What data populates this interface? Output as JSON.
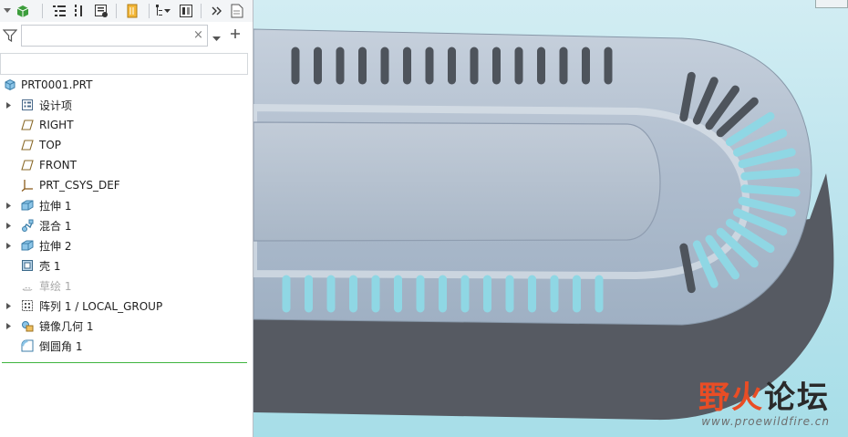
{
  "search": {
    "value": ""
  },
  "tree": [
    {
      "label": "PRT0001.PRT",
      "icon": "part-icon",
      "expandable": false
    },
    {
      "label": "设计项",
      "icon": "design-items-icon",
      "expandable": true
    },
    {
      "label": "RIGHT",
      "icon": "datum-plane-icon",
      "expandable": false
    },
    {
      "label": "TOP",
      "icon": "datum-plane-icon",
      "expandable": false
    },
    {
      "label": "FRONT",
      "icon": "datum-plane-icon",
      "expandable": false
    },
    {
      "label": "PRT_CSYS_DEF",
      "icon": "csys-icon",
      "expandable": false
    },
    {
      "label": "拉伸 1",
      "icon": "extrude-icon",
      "expandable": true
    },
    {
      "label": "混合 1",
      "icon": "blend-icon",
      "expandable": true
    },
    {
      "label": "拉伸 2",
      "icon": "extrude-icon",
      "expandable": true
    },
    {
      "label": "壳 1",
      "icon": "shell-icon",
      "expandable": false
    },
    {
      "label": "草绘 1",
      "icon": "sketch-icon",
      "expandable": false,
      "dim": true
    },
    {
      "label": "阵列 1 / LOCAL_GROUP",
      "icon": "pattern-icon",
      "expandable": true
    },
    {
      "label": "镜像几何 1",
      "icon": "mirror-icon",
      "expandable": true
    },
    {
      "label": "倒圆角 1",
      "icon": "round-icon",
      "expandable": false
    }
  ],
  "watermark": {
    "logo_a": "野火",
    "logo_b": "论坛",
    "url": "www.proewildfire.cn"
  },
  "colors": {
    "model_top": "#b4c0d0",
    "model_side": "#565a62",
    "background": "#b8e4ec",
    "insert_line": "#3fb53f"
  }
}
